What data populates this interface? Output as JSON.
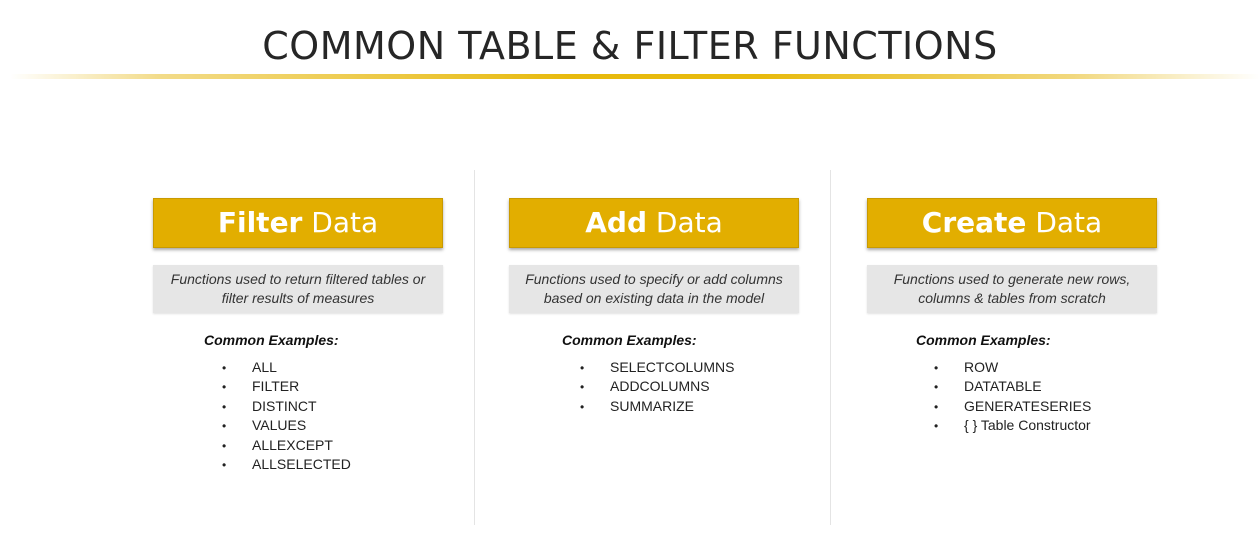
{
  "slide": {
    "title": "COMMON TABLE & FILTER FUNCTIONS",
    "accent_color": "#E2AE00",
    "columns": [
      {
        "header_bold": "Filter",
        "header_rest": " Data",
        "description": "Functions used to return filtered tables or filter results of measures",
        "examples_label": "Common Examples:",
        "examples": [
          "ALL",
          "FILTER",
          "DISTINCT",
          "VALUES",
          "ALLEXCEPT",
          "ALLSELECTED"
        ]
      },
      {
        "header_bold": "Add",
        "header_rest": " Data",
        "description": "Functions used to specify or add columns based on existing data in the model",
        "examples_label": "Common Examples:",
        "examples": [
          "SELECTCOLUMNS",
          "ADDCOLUMNS",
          "SUMMARIZE"
        ]
      },
      {
        "header_bold": "Create",
        "header_rest": " Data",
        "description": "Functions used to generate new rows, columns & tables from scratch",
        "examples_label": "Common Examples:",
        "examples": [
          "ROW",
          "DATATABLE",
          "GENERATESERIES",
          "{ } Table Constructor"
        ]
      }
    ]
  }
}
